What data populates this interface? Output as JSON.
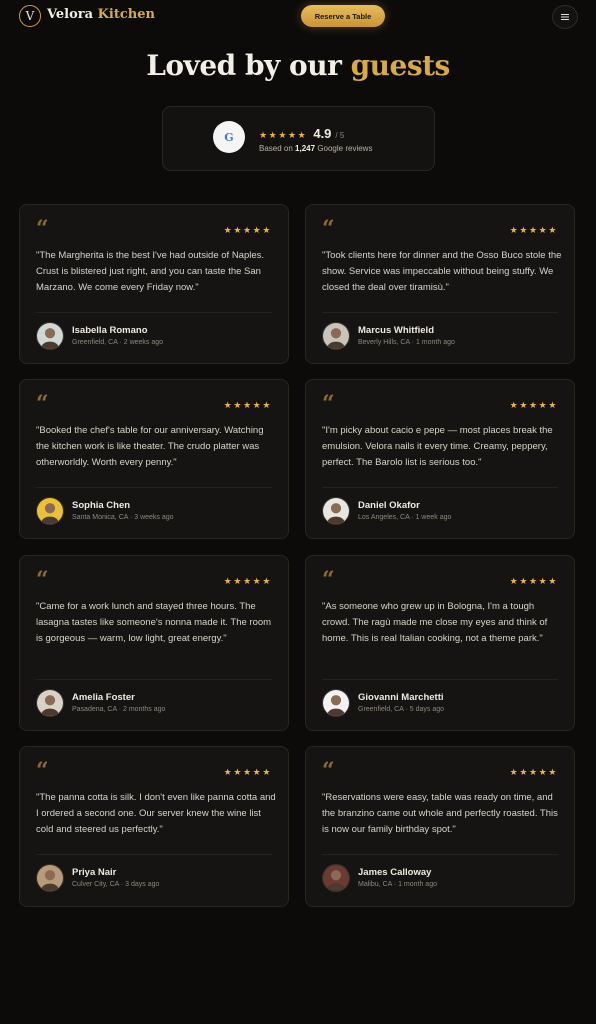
{
  "nav": {
    "logo_letter": "V",
    "brand_first": "Velora",
    "brand_second": "Kitchen",
    "reserve_label": "Reserve a Table",
    "menu_icon": "hamburger-icon"
  },
  "hero": {
    "headline_main": "Loved by our",
    "headline_accent": "guests"
  },
  "rating": {
    "source_letter": "G",
    "stars": "★★★★★",
    "score": "4.9",
    "out_of": "/ 5",
    "based_on": "Based on",
    "count": "1,247",
    "source_text": "Google reviews"
  },
  "colors": {
    "accent": "#d7a94a",
    "star": "#e6b24a",
    "background": "#0c0b0a",
    "card": "#151412"
  },
  "reviews": [
    {
      "stars": "★★★★★",
      "quote": "\"The Margherita is the best I've had outside of Naples. Crust is blistered just right, and you can taste the San Marzano. We come every Friday now.\"",
      "name": "Isabella Romano",
      "meta": "Greenfield, CA · 2 weeks ago",
      "avatar_color": "#cfd8d4"
    },
    {
      "stars": "★★★★★",
      "quote": "\"Took clients here for dinner and the Osso Buco stole the show. Service was impeccable without being stuffy. We closed the deal over tiramisù.\"",
      "name": "Marcus Whitfield",
      "meta": "Beverly Hills, CA · 1 month ago",
      "avatar_color": "#c9c3bb"
    },
    {
      "stars": "★★★★★",
      "quote": "\"Booked the chef's table for our anniversary. Watching the kitchen work is like theater. The crudo platter was otherworldly. Worth every penny.\"",
      "name": "Sophia Chen",
      "meta": "Santa Monica, CA · 3 weeks ago",
      "avatar_color": "#e9c23a"
    },
    {
      "stars": "★★★★★",
      "quote": "\"I'm picky about cacio e pepe — most places break the emulsion. Velora nails it every time. Creamy, peppery, perfect. The Barolo list is serious too.\"",
      "name": "Daniel Okafor",
      "meta": "Los Angeles, CA · 1 week ago",
      "avatar_color": "#e8e6e2"
    },
    {
      "stars": "★★★★★",
      "quote": "\"Came for a work lunch and stayed three hours. The lasagna tastes like someone's nonna made it. The room is gorgeous — warm, low light, great energy.\"",
      "name": "Amelia Foster",
      "meta": "Pasadena, CA · 2 months ago",
      "avatar_color": "#d9d2c6"
    },
    {
      "stars": "★★★★★",
      "quote": "\"As someone who grew up in Bologna, I'm a tough crowd. The ragù made me close my eyes and think of home. This is real Italian cooking, not a theme park.\"",
      "name": "Giovanni Marchetti",
      "meta": "Greenfield, CA · 5 days ago",
      "avatar_color": "#f2f2f2"
    },
    {
      "stars": "★★★★★",
      "quote": "\"The panna cotta is silk. I don't even like panna cotta and I ordered a second one. Our server knew the wine list cold and steered us perfectly.\"",
      "name": "Priya Nair",
      "meta": "Culver City, CA · 3 days ago",
      "avatar_color": "#b99a7a"
    },
    {
      "stars": "★★★★★",
      "quote": "\"Reservations were easy, table was ready on time, and the branzino came out whole and perfectly roasted. This is now our family birthday spot.\"",
      "name": "James Calloway",
      "meta": "Malibu, CA · 1 month ago",
      "avatar_color": "#6a3b32"
    }
  ]
}
